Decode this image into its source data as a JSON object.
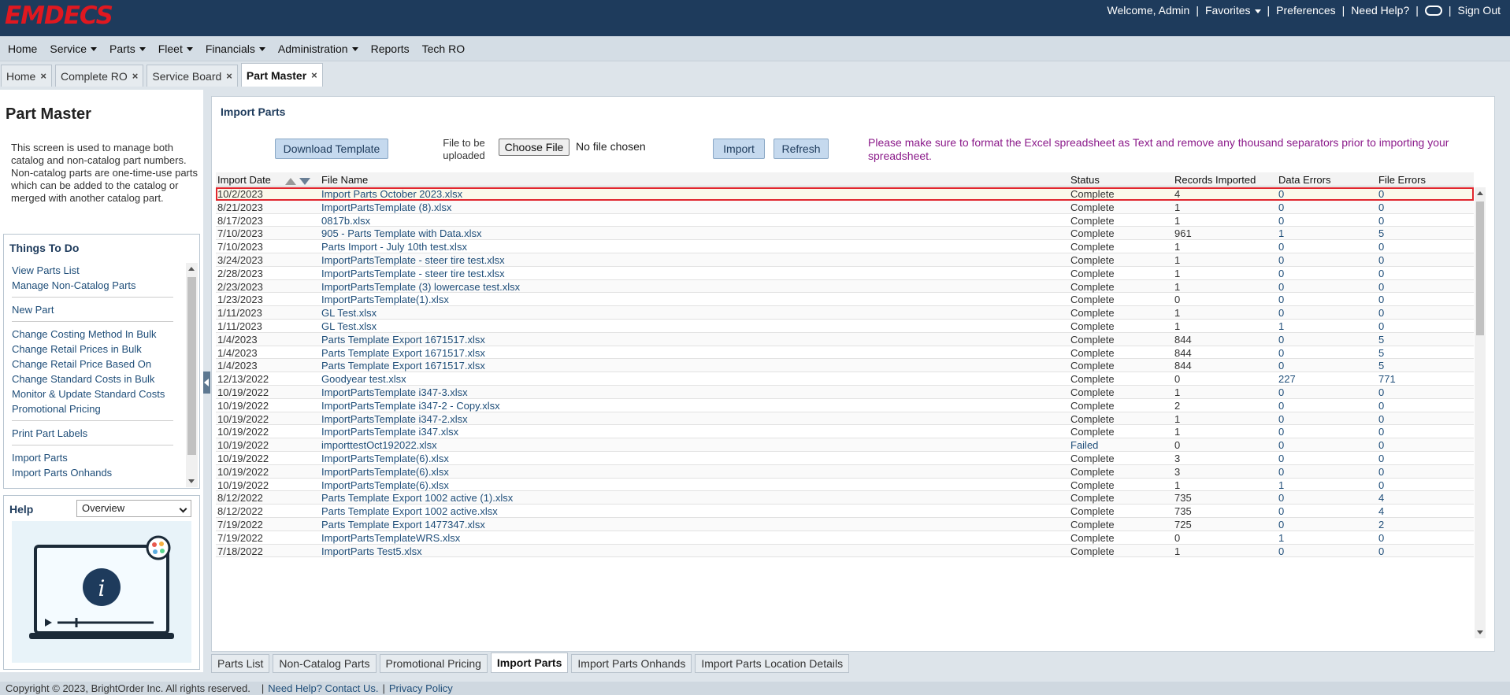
{
  "brand": {
    "logo": "EMDECS"
  },
  "top_nav": {
    "welcome": "Welcome, Admin",
    "favorites": "Favorites",
    "preferences": "Preferences",
    "help": "Need Help?",
    "signout": "Sign Out"
  },
  "menu": [
    "Home",
    "Service",
    "Parts",
    "Fleet",
    "Financials",
    "Administration",
    "Reports",
    "Tech RO"
  ],
  "menu_dropdown": [
    false,
    true,
    true,
    true,
    true,
    true,
    false,
    false
  ],
  "page_tabs": [
    "Home",
    "Complete RO",
    "Service Board",
    "Part Master"
  ],
  "sidebar": {
    "title": "Part Master",
    "description": "This screen is used to manage both catalog and non-catalog part numbers. Non-catalog parts are one-time-use parts which can be added to the catalog or merged with another catalog part.",
    "todo_title": "Things To Do",
    "todo_items": [
      "View Parts List",
      "Manage Non-Catalog Parts",
      "New Part",
      "Change Costing Method In Bulk",
      "Change Retail Prices in Bulk",
      "Change Retail Price Based On",
      "Change Standard Costs in Bulk",
      "Monitor & Update Standard Costs",
      "Promotional Pricing",
      "Print Part Labels",
      "Import Parts",
      "Import Parts Onhands"
    ],
    "help_title": "Help",
    "help_select": "Overview"
  },
  "main": {
    "title": "Import Parts",
    "download_button": "Download Template",
    "file_label": "File to be uploaded",
    "choose_button": "Choose File",
    "no_file": "No file chosen",
    "import_button": "Import",
    "refresh_button": "Refresh",
    "notice": "Please make sure to format the Excel spreadsheet as Text and remove any thousand separators prior to importing your spreadsheet."
  },
  "grid": {
    "columns": [
      "Import Date",
      "File Name",
      "Status",
      "Records Imported",
      "Data Errors",
      "File Errors"
    ],
    "rows": [
      [
        "10/2/2023",
        "Import Parts October 2023.xlsx",
        "Complete",
        "4",
        "0",
        "0"
      ],
      [
        "8/21/2023",
        "ImportPartsTemplate (8).xlsx",
        "Complete",
        "1",
        "0",
        "0"
      ],
      [
        "8/17/2023",
        "0817b.xlsx",
        "Complete",
        "1",
        "0",
        "0"
      ],
      [
        "7/10/2023",
        "905 - Parts Template with Data.xlsx",
        "Complete",
        "961",
        "1",
        "5"
      ],
      [
        "7/10/2023",
        "Parts Import - July 10th test.xlsx",
        "Complete",
        "1",
        "0",
        "0"
      ],
      [
        "3/24/2023",
        "ImportPartsTemplate - steer tire test.xlsx",
        "Complete",
        "1",
        "0",
        "0"
      ],
      [
        "2/28/2023",
        "ImportPartsTemplate - steer tire test.xlsx",
        "Complete",
        "1",
        "0",
        "0"
      ],
      [
        "2/23/2023",
        "ImportPartsTemplate (3) lowercase test.xlsx",
        "Complete",
        "1",
        "0",
        "0"
      ],
      [
        "1/23/2023",
        "ImportPartsTemplate(1).xlsx",
        "Complete",
        "0",
        "0",
        "0"
      ],
      [
        "1/11/2023",
        "GL Test.xlsx",
        "Complete",
        "1",
        "0",
        "0"
      ],
      [
        "1/11/2023",
        "GL Test.xlsx",
        "Complete",
        "1",
        "1",
        "0"
      ],
      [
        "1/4/2023",
        "Parts Template Export 1671517.xlsx",
        "Complete",
        "844",
        "0",
        "5"
      ],
      [
        "1/4/2023",
        "Parts Template Export 1671517.xlsx",
        "Complete",
        "844",
        "0",
        "5"
      ],
      [
        "1/4/2023",
        "Parts Template Export 1671517.xlsx",
        "Complete",
        "844",
        "0",
        "5"
      ],
      [
        "12/13/2022",
        "Goodyear test.xlsx",
        "Complete",
        "0",
        "227",
        "771"
      ],
      [
        "10/19/2022",
        "ImportPartsTemplate i347-3.xlsx",
        "Complete",
        "1",
        "0",
        "0"
      ],
      [
        "10/19/2022",
        "ImportPartsTemplate i347-2 - Copy.xlsx",
        "Complete",
        "2",
        "0",
        "0"
      ],
      [
        "10/19/2022",
        "ImportPartsTemplate i347-2.xlsx",
        "Complete",
        "1",
        "0",
        "0"
      ],
      [
        "10/19/2022",
        "ImportPartsTemplate i347.xlsx",
        "Complete",
        "1",
        "0",
        "0"
      ],
      [
        "10/19/2022",
        "importtestOct192022.xlsx",
        "Failed",
        "0",
        "0",
        "0"
      ],
      [
        "10/19/2022",
        "ImportPartsTemplate(6).xlsx",
        "Complete",
        "3",
        "0",
        "0"
      ],
      [
        "10/19/2022",
        "ImportPartsTemplate(6).xlsx",
        "Complete",
        "3",
        "0",
        "0"
      ],
      [
        "10/19/2022",
        "ImportPartsTemplate(6).xlsx",
        "Complete",
        "1",
        "1",
        "0"
      ],
      [
        "8/12/2022",
        "Parts Template Export 1002 active (1).xlsx",
        "Complete",
        "735",
        "0",
        "4"
      ],
      [
        "8/12/2022",
        "Parts Template Export 1002 active.xlsx",
        "Complete",
        "735",
        "0",
        "4"
      ],
      [
        "7/19/2022",
        "Parts Template Export 1477347.xlsx",
        "Complete",
        "725",
        "0",
        "2"
      ],
      [
        "7/19/2022",
        "ImportPartsTemplateWRS.xlsx",
        "Complete",
        "0",
        "1",
        "0"
      ],
      [
        "7/18/2022",
        "ImportParts Test5.xlsx",
        "Complete",
        "1",
        "0",
        "0"
      ]
    ]
  },
  "bottom_tabs": [
    "Parts List",
    "Non-Catalog Parts",
    "Promotional Pricing",
    "Import Parts",
    "Import Parts Onhands",
    "Import Parts Location Details"
  ],
  "footer": {
    "copyright": "Copyright © 2023, BrightOrder Inc. All rights reserved.",
    "help_link": "Need Help? Contact Us.",
    "privacy_link": "Privacy Policy"
  },
  "colors": {
    "header_bg": "#1e3b5c",
    "logo_red": "#e01820",
    "link_blue": "#1f4e79",
    "notice_purple": "#8b1a8a",
    "selection_outline": "#e0262e"
  }
}
